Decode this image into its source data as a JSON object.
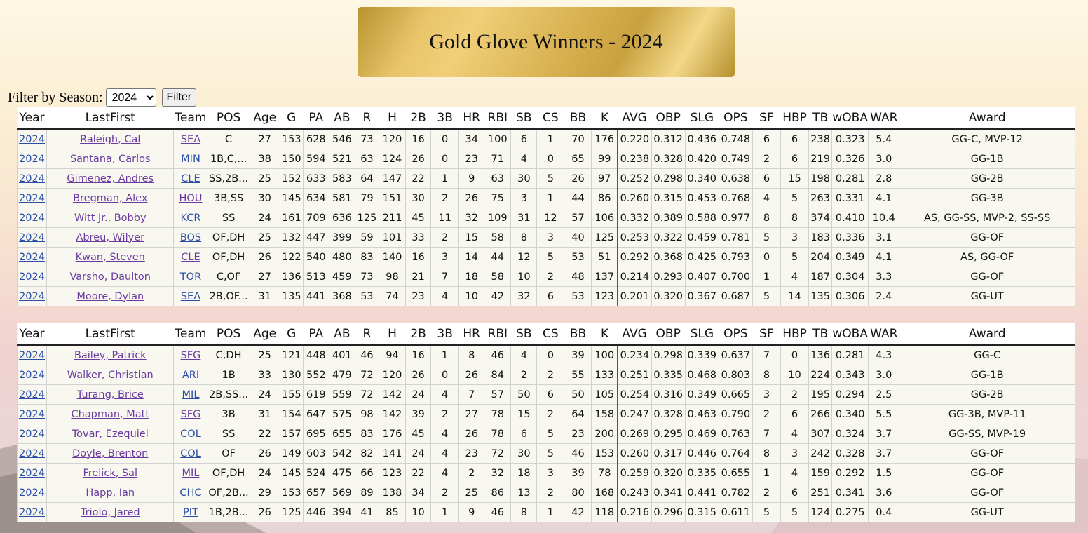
{
  "page": {
    "title": "Gold Glove Winners - 2024"
  },
  "filter": {
    "label": "Filter by Season:",
    "selected": "2024",
    "button": "Filter"
  },
  "columns": [
    "Year",
    "LastFirst",
    "Team",
    "POS",
    "Age",
    "G",
    "PA",
    "AB",
    "R",
    "H",
    "2B",
    "3B",
    "HR",
    "RBI",
    "SB",
    "CS",
    "BB",
    "K",
    "AVG",
    "OBP",
    "SLG",
    "OPS",
    "SF",
    "HBP",
    "TB",
    "wOBA",
    "WAR",
    "Award"
  ],
  "tables": [
    {
      "name": "al-table",
      "rows": [
        [
          "2024",
          "Raleigh, Cal",
          "SEA",
          "C",
          "27",
          "153",
          "628",
          "546",
          "73",
          "120",
          "16",
          "0",
          "34",
          "100",
          "6",
          "1",
          "70",
          "176",
          "0.220",
          "0.312",
          "0.436",
          "0.748",
          "6",
          "6",
          "238",
          "0.323",
          "5.4",
          "GG-C, MVP-12"
        ],
        [
          "2024",
          "Santana, Carlos",
          "MIN",
          "1B,C,...",
          "38",
          "150",
          "594",
          "521",
          "63",
          "124",
          "26",
          "0",
          "23",
          "71",
          "4",
          "0",
          "65",
          "99",
          "0.238",
          "0.328",
          "0.420",
          "0.749",
          "2",
          "6",
          "219",
          "0.326",
          "3.0",
          "GG-1B"
        ],
        [
          "2024",
          "Gimenez, Andres",
          "CLE",
          "SS,2B...",
          "25",
          "152",
          "633",
          "583",
          "64",
          "147",
          "22",
          "1",
          "9",
          "63",
          "30",
          "5",
          "26",
          "97",
          "0.252",
          "0.298",
          "0.340",
          "0.638",
          "6",
          "15",
          "198",
          "0.281",
          "2.8",
          "GG-2B"
        ],
        [
          "2024",
          "Bregman, Alex",
          "HOU",
          "3B,SS",
          "30",
          "145",
          "634",
          "581",
          "79",
          "151",
          "30",
          "2",
          "26",
          "75",
          "3",
          "1",
          "44",
          "86",
          "0.260",
          "0.315",
          "0.453",
          "0.768",
          "4",
          "5",
          "263",
          "0.331",
          "4.1",
          "GG-3B"
        ],
        [
          "2024",
          "Witt Jr., Bobby",
          "KCR",
          "SS",
          "24",
          "161",
          "709",
          "636",
          "125",
          "211",
          "45",
          "11",
          "32",
          "109",
          "31",
          "12",
          "57",
          "106",
          "0.332",
          "0.389",
          "0.588",
          "0.977",
          "8",
          "8",
          "374",
          "0.410",
          "10.4",
          "AS, GG-SS, MVP-2, SS-SS"
        ],
        [
          "2024",
          "Abreu, Wilyer",
          "BOS",
          "OF,DH",
          "25",
          "132",
          "447",
          "399",
          "59",
          "101",
          "33",
          "2",
          "15",
          "58",
          "8",
          "3",
          "40",
          "125",
          "0.253",
          "0.322",
          "0.459",
          "0.781",
          "5",
          "3",
          "183",
          "0.336",
          "3.1",
          "GG-OF"
        ],
        [
          "2024",
          "Kwan, Steven",
          "CLE",
          "OF,DH",
          "26",
          "122",
          "540",
          "480",
          "83",
          "140",
          "16",
          "3",
          "14",
          "44",
          "12",
          "5",
          "53",
          "51",
          "0.292",
          "0.368",
          "0.425",
          "0.793",
          "0",
          "5",
          "204",
          "0.349",
          "4.1",
          "AS, GG-OF"
        ],
        [
          "2024",
          "Varsho, Daulton",
          "TOR",
          "C,OF",
          "27",
          "136",
          "513",
          "459",
          "73",
          "98",
          "21",
          "7",
          "18",
          "58",
          "10",
          "2",
          "48",
          "137",
          "0.214",
          "0.293",
          "0.407",
          "0.700",
          "1",
          "4",
          "187",
          "0.304",
          "3.3",
          "GG-OF"
        ],
        [
          "2024",
          "Moore, Dylan",
          "SEA",
          "2B,OF...",
          "31",
          "135",
          "441",
          "368",
          "53",
          "74",
          "23",
          "4",
          "10",
          "42",
          "32",
          "6",
          "53",
          "123",
          "0.201",
          "0.320",
          "0.367",
          "0.687",
          "5",
          "14",
          "135",
          "0.306",
          "2.4",
          "GG-UT"
        ]
      ]
    },
    {
      "name": "nl-table",
      "rows": [
        [
          "2024",
          "Bailey, Patrick",
          "SFG",
          "C,DH",
          "25",
          "121",
          "448",
          "401",
          "46",
          "94",
          "16",
          "1",
          "8",
          "46",
          "4",
          "0",
          "39",
          "100",
          "0.234",
          "0.298",
          "0.339",
          "0.637",
          "7",
          "0",
          "136",
          "0.281",
          "4.3",
          "GG-C"
        ],
        [
          "2024",
          "Walker, Christian",
          "ARI",
          "1B",
          "33",
          "130",
          "552",
          "479",
          "72",
          "120",
          "26",
          "0",
          "26",
          "84",
          "2",
          "2",
          "55",
          "133",
          "0.251",
          "0.335",
          "0.468",
          "0.803",
          "8",
          "10",
          "224",
          "0.343",
          "3.0",
          "GG-1B"
        ],
        [
          "2024",
          "Turang, Brice",
          "MIL",
          "2B,SS...",
          "24",
          "155",
          "619",
          "559",
          "72",
          "142",
          "24",
          "4",
          "7",
          "57",
          "50",
          "6",
          "50",
          "105",
          "0.254",
          "0.316",
          "0.349",
          "0.665",
          "3",
          "2",
          "195",
          "0.294",
          "2.5",
          "GG-2B"
        ],
        [
          "2024",
          "Chapman, Matt",
          "SFG",
          "3B",
          "31",
          "154",
          "647",
          "575",
          "98",
          "142",
          "39",
          "2",
          "27",
          "78",
          "15",
          "2",
          "64",
          "158",
          "0.247",
          "0.328",
          "0.463",
          "0.790",
          "2",
          "6",
          "266",
          "0.340",
          "5.5",
          "GG-3B, MVP-11"
        ],
        [
          "2024",
          "Tovar, Ezequiel",
          "COL",
          "SS",
          "22",
          "157",
          "695",
          "655",
          "83",
          "176",
          "45",
          "4",
          "26",
          "78",
          "6",
          "5",
          "23",
          "200",
          "0.269",
          "0.295",
          "0.469",
          "0.763",
          "7",
          "4",
          "307",
          "0.324",
          "3.7",
          "GG-SS, MVP-19"
        ],
        [
          "2024",
          "Doyle, Brenton",
          "COL",
          "OF",
          "26",
          "149",
          "603",
          "542",
          "82",
          "141",
          "24",
          "4",
          "23",
          "72",
          "30",
          "5",
          "46",
          "153",
          "0.260",
          "0.317",
          "0.446",
          "0.764",
          "8",
          "3",
          "242",
          "0.328",
          "3.7",
          "GG-OF"
        ],
        [
          "2024",
          "Frelick, Sal",
          "MIL",
          "OF,DH",
          "24",
          "145",
          "524",
          "475",
          "66",
          "123",
          "22",
          "4",
          "2",
          "32",
          "18",
          "3",
          "39",
          "78",
          "0.259",
          "0.320",
          "0.335",
          "0.655",
          "1",
          "4",
          "159",
          "0.292",
          "1.5",
          "GG-OF"
        ],
        [
          "2024",
          "Happ, Ian",
          "CHC",
          "OF,2B...",
          "29",
          "153",
          "657",
          "569",
          "89",
          "138",
          "34",
          "2",
          "25",
          "86",
          "13",
          "2",
          "80",
          "168",
          "0.243",
          "0.341",
          "0.441",
          "0.782",
          "2",
          "6",
          "251",
          "0.341",
          "3.6",
          "GG-OF"
        ],
        [
          "2024",
          "Triolo, Jared",
          "PIT",
          "1B,2B...",
          "26",
          "125",
          "446",
          "394",
          "41",
          "85",
          "10",
          "1",
          "9",
          "46",
          "8",
          "1",
          "42",
          "118",
          "0.216",
          "0.296",
          "0.315",
          "0.611",
          "5",
          "5",
          "124",
          "0.275",
          "0.4",
          "GG-UT"
        ]
      ]
    }
  ]
}
